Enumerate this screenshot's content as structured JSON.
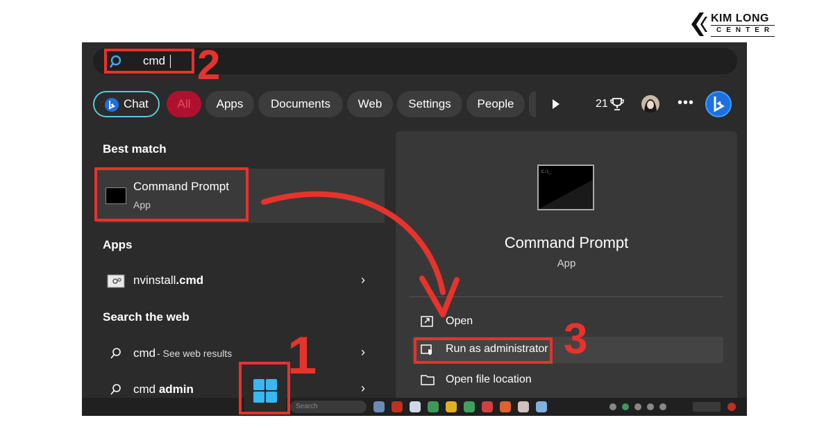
{
  "logo": {
    "line1": "KIM LONG",
    "line2": "CENTER"
  },
  "search": {
    "value": "cmd"
  },
  "filters": {
    "chat": "Chat",
    "all": "All",
    "apps": "Apps",
    "documents": "Documents",
    "web": "Web",
    "settings": "Settings",
    "people": "People",
    "points": "21"
  },
  "left": {
    "best_match_heading": "Best match",
    "best_match": {
      "title": "Command Prompt",
      "subtitle": "App"
    },
    "apps_heading": "Apps",
    "app_item": {
      "name_prefix": "nvinstall",
      "name_ext": ".cmd"
    },
    "web_heading": "Search the web",
    "web_results": [
      {
        "query": "cmd",
        "suffix": " - See web results"
      },
      {
        "query_prefix": "cmd ",
        "query_bold": "admin"
      }
    ]
  },
  "right": {
    "title": "Command Prompt",
    "subtitle": "App",
    "actions": [
      "Open",
      "Run as administrator",
      "Open file location"
    ]
  },
  "taskbar": {
    "search_placeholder": "Search"
  },
  "annotations": {
    "step1": "1",
    "step2": "2",
    "step3": "3"
  },
  "colors": {
    "annotation_red": "#e8322c",
    "accent_teal": "#5ac8d8",
    "all_filter": "#b01030"
  }
}
